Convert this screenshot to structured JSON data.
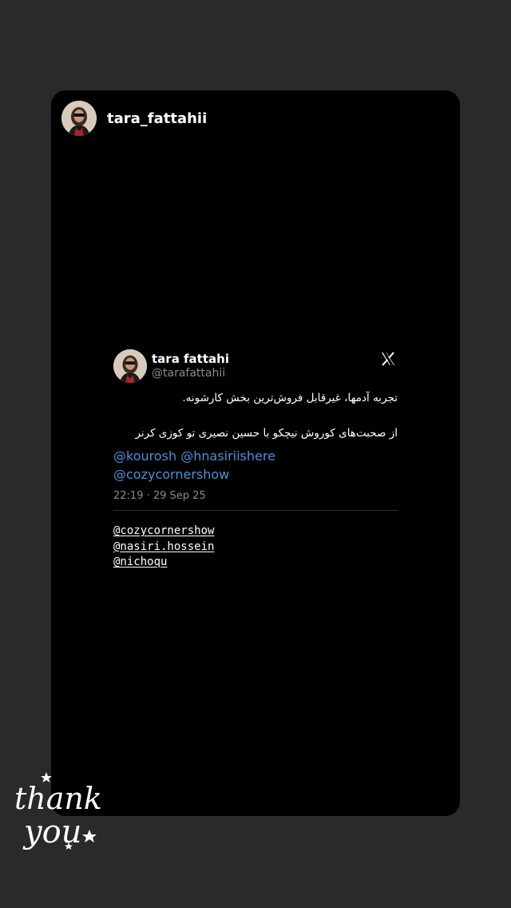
{
  "story": {
    "username": "tara_fattahii"
  },
  "tweet": {
    "display_name": "tara fattahi",
    "handle": "@tarafattahii",
    "logo": "x-logo-icon",
    "text_line1": "تجربه آدمها، غیرقابل فروش‌ترین بخش کارشونه.",
    "text_line2": "از صحبت‌های کوروش نیچکو با حسین نصیری تو کوزی کرنر",
    "mention_1": "@kourosh",
    "mention_2": "@hnasiriishere",
    "mention_3": "@cozycornershow",
    "timestamp": "22:19 · 29 Sep 25"
  },
  "tags": [
    "@cozycornershow",
    "@nasiri.hossein",
    "@nichoqu"
  ],
  "sticker": {
    "line1": "thank",
    "line2": "you"
  },
  "colors": {
    "background": "#2a2a2a",
    "card": "#000000",
    "link": "#4a90d9",
    "muted": "#8b8b8b"
  }
}
